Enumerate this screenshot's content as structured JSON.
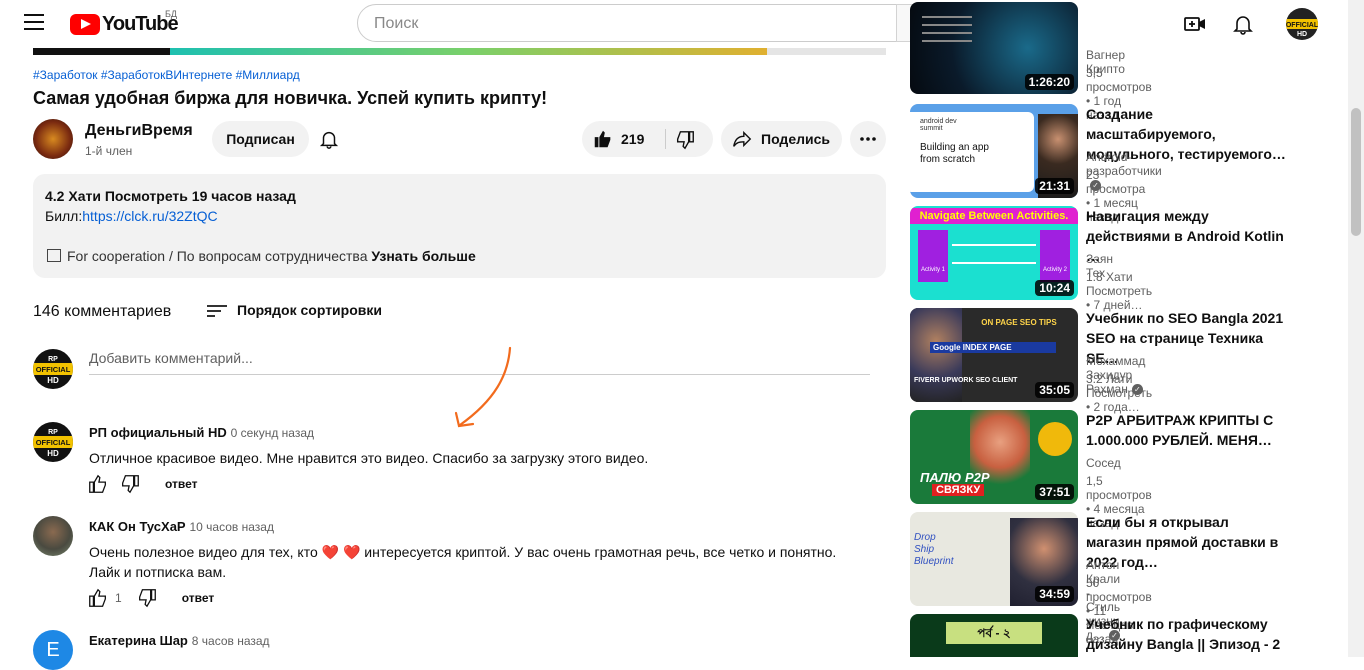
{
  "header": {
    "logo_text": "YouTube",
    "country_code": "БД",
    "search_placeholder": "Поиск"
  },
  "video": {
    "hashtags": "#Заработок #ЗаработокВИнтернете #Миллиард",
    "title": "Самая удобная биржа для новичка. Успей купить крипту!",
    "progress_percent": 86,
    "channel": {
      "name": "ДеньгиВремя",
      "subscribers": "1-й член",
      "subscribed_label": "Подписан"
    },
    "likes": "219",
    "share_label": "Поделись",
    "description": {
      "stats": "4.2 Хати Посмотреть 19 часов назад",
      "link_label": "Билл:",
      "link": "https://clck.ru/32ZtQC",
      "cooperation": "For cooperation / По вопросам сотрудничества",
      "more": "Узнать больше"
    }
  },
  "comments": {
    "count_label": "146 комментариев",
    "sort_label": "Порядок сортировки",
    "add_placeholder": "Добавить комментарий...",
    "reply_label": "ответ",
    "items": [
      {
        "author": "РП официальный HD",
        "time": "0 секунд назад",
        "text": "Отличное красивое видео. Мне нравится это видео. Спасибо за загрузку этого видео.",
        "likes": ""
      },
      {
        "author": "КАК Он ТусХаР",
        "time": "10 часов назад",
        "text_before": "Очень полезное видео для тех, кто",
        "hearts": "❤️ ❤️",
        "text_after": "интересуется криптой. У вас очень грамотная речь, все четко и понятно.",
        "text_line2": "Лайк и потписка вам.",
        "likes": "1"
      },
      {
        "author": "Екатерина Шар",
        "time": "8 часов назад",
        "avatar_letter": "Е"
      }
    ]
  },
  "sidebar": {
    "items": [
      {
        "title": "",
        "channel": "Вагнер Крипто",
        "meta": "3,5 просмотров • 1 год назад",
        "duration": "1:26:20",
        "verified": false
      },
      {
        "title": "Создание масштабируемого, модульного, тестируемого…",
        "channel": "Android-разработчики",
        "meta": "23 просмотра • 1 месяц назад",
        "duration": "21:31",
        "verified": true,
        "thumb_text1": "android dev summit",
        "thumb_text2": "Building an app from scratch"
      },
      {
        "title": "Навигация между действиями в Android Kotlin …",
        "channel": "Заян Тех",
        "meta": "1.8 Хати Посмотреть • 7 дней…",
        "duration": "10:24",
        "verified": false,
        "thumb_text1": "Navigate Between Activities.",
        "thumb_text2": "Activity 1",
        "thumb_text3": "Activity 2"
      },
      {
        "title": "Учебник по SEO Bangla 2021 SEO на странице Техника SE…",
        "channel": "Мохаммад Захидур Рахман",
        "meta": "3.2 Лати Посмотреть • 2 года…",
        "duration": "35:05",
        "verified": true,
        "thumb_text1": "ON PAGE SEO TIPS",
        "thumb_text2": "Google INDEX PAGE",
        "thumb_text3": "FIVERR UPWORK SEO CLIENT"
      },
      {
        "title": "P2P АРБИТРАЖ КРИПТЫ С 1.000.000 РУБЛЕЙ. МЕНЯ…",
        "channel": "Сосед",
        "meta": "1,5 просмотров • 4 месяца назад",
        "duration": "37:51",
        "verified": false,
        "thumb_text1": "ПАЛЮ P2P",
        "thumb_text2": "СВЯЗКУ"
      },
      {
        "title": "Если бы я открывал магазин прямой доставки в 2022 год…",
        "channel": "Антон Крали - Стиль жизни д…",
        "meta": "50 просмотров • 11 месяцев назад",
        "duration": "34:59",
        "verified": true,
        "thumb_text1": "Drop Ship Blueprint"
      },
      {
        "title": "Учебник по графическому дизайну Bangla || Эпизод - 2",
        "channel": "",
        "meta": "",
        "duration": "",
        "verified": false,
        "thumb_text1": "পর্ব - ২"
      }
    ]
  },
  "colors": {
    "brand_red": "#ff0000",
    "link_blue": "#065fd4",
    "annotation_arrow": "#f26b1d"
  }
}
